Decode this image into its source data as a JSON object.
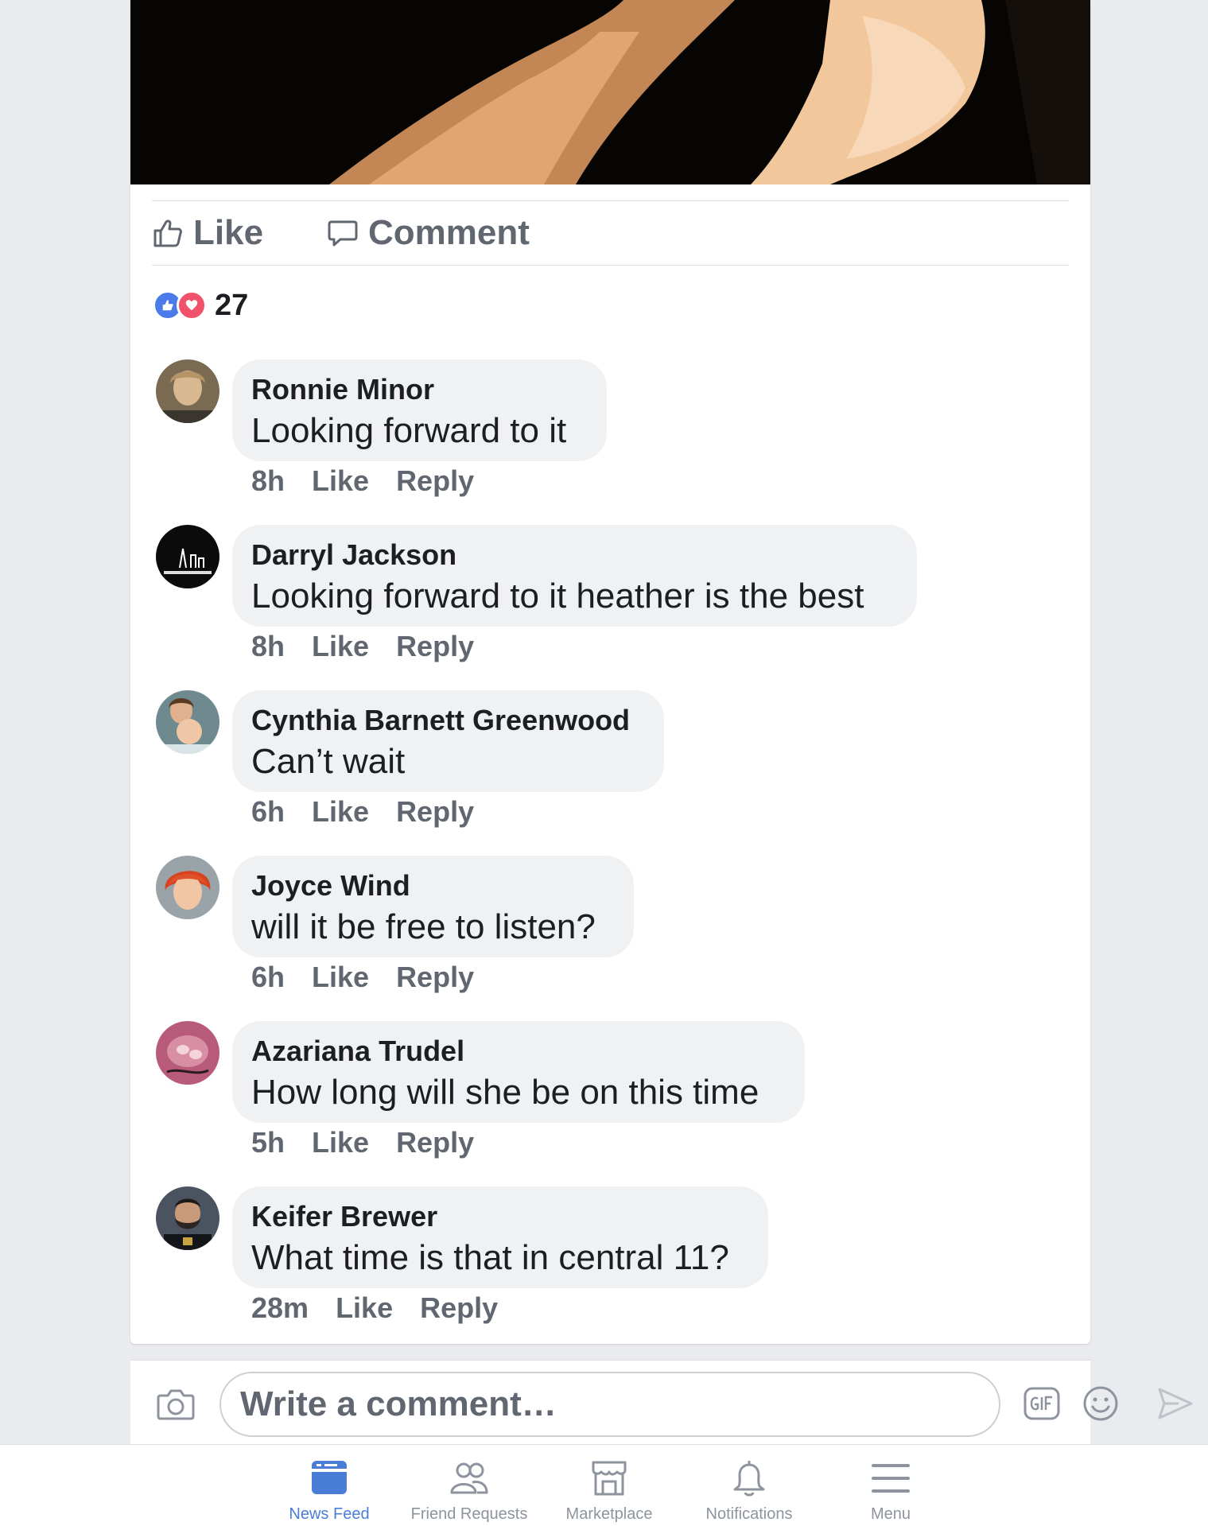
{
  "actions": {
    "like_label": "Like",
    "comment_label": "Comment"
  },
  "reactions": {
    "count": "27",
    "icons": [
      "like-reaction-icon",
      "love-reaction-icon"
    ]
  },
  "comments": [
    {
      "author": "Ronnie Minor",
      "text": "Looking forward to it",
      "time": "8h",
      "like": "Like",
      "reply": "Reply"
    },
    {
      "author": "Darryl Jackson",
      "text": "Looking forward to it heather is the best",
      "time": "8h",
      "like": "Like",
      "reply": "Reply"
    },
    {
      "author": "Cynthia Barnett Greenwood",
      "text": "Can’t wait",
      "time": "6h",
      "like": "Like",
      "reply": "Reply"
    },
    {
      "author": "Joyce Wind",
      "text": "will it be free to listen?",
      "time": "6h",
      "like": "Like",
      "reply": "Reply"
    },
    {
      "author": "Azariana Trudel",
      "text": "How long will she be on this time",
      "time": "5h",
      "like": "Like",
      "reply": "Reply"
    },
    {
      "author": "Keifer Brewer",
      "text": "What time is that in central 11?",
      "time": "28m",
      "like": "Like",
      "reply": "Reply"
    }
  ],
  "composer": {
    "placeholder": "Write a comment…"
  },
  "tabs": [
    {
      "label": "News Feed",
      "icon": "news-feed-icon",
      "active": true
    },
    {
      "label": "Friend Requests",
      "icon": "friend-requests-icon",
      "active": false
    },
    {
      "label": "Marketplace",
      "icon": "marketplace-icon",
      "active": false
    },
    {
      "label": "Notifications",
      "icon": "notifications-icon",
      "active": false
    },
    {
      "label": "Menu",
      "icon": "menu-icon",
      "active": false
    }
  ],
  "colors": {
    "accent": "#4a7dd6",
    "like_blue": "#4a7be9",
    "love_red": "#f0526a",
    "meta_gray": "#606770",
    "bubble": "#f0f1f3"
  }
}
